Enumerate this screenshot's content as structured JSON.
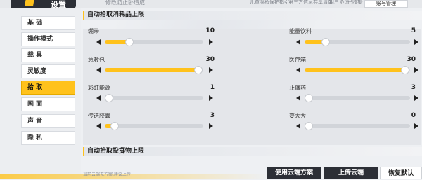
{
  "header": {
    "title": "设置",
    "subtitle": "修改防止卧造成",
    "links": [
      "儿童隐私保护指引",
      "第三方信息共享清单",
      "用户协议",
      "ACE",
      "已收集个人信息清单"
    ],
    "account_button": "账号管理"
  },
  "sidebar": {
    "items": [
      {
        "label": "基 础",
        "active": false
      },
      {
        "label": "操作模式",
        "active": false
      },
      {
        "label": "载 具",
        "active": false
      },
      {
        "label": "灵敏度",
        "active": false
      },
      {
        "label": "拾 取",
        "active": true
      },
      {
        "label": "画 面",
        "active": false
      },
      {
        "label": "声 音",
        "active": false
      },
      {
        "label": "隐 私",
        "active": false
      }
    ]
  },
  "sections": {
    "consumables_title": "自动拾取消耗品上限",
    "throwables_title": "自动拾取投掷物上限"
  },
  "sliders": [
    {
      "label": "绷带",
      "value": "10",
      "fill": 0.25
    },
    {
      "label": "能量饮料",
      "value": "5",
      "fill": 0.2
    },
    {
      "label": "急救包",
      "value": "30",
      "fill": 0.95
    },
    {
      "label": "医疗箱",
      "value": "30",
      "fill": 0.95
    },
    {
      "label": "彩虹能源",
      "value": "1",
      "fill": 0.0
    },
    {
      "label": "止痛药",
      "value": "3",
      "fill": 0.0
    },
    {
      "label": "传送胶囊",
      "value": "3",
      "fill": 0.1
    },
    {
      "label": "变大大",
      "value": "0",
      "fill": 0.0
    }
  ],
  "footer": {
    "note": "当前云端无方案,建议上传",
    "use_cloud": "使用云端方案",
    "upload_cloud": "上传云端",
    "restore_default": "恢复默认"
  },
  "colors": {
    "accent": "#ffc21c",
    "dark": "#2c2f36"
  }
}
